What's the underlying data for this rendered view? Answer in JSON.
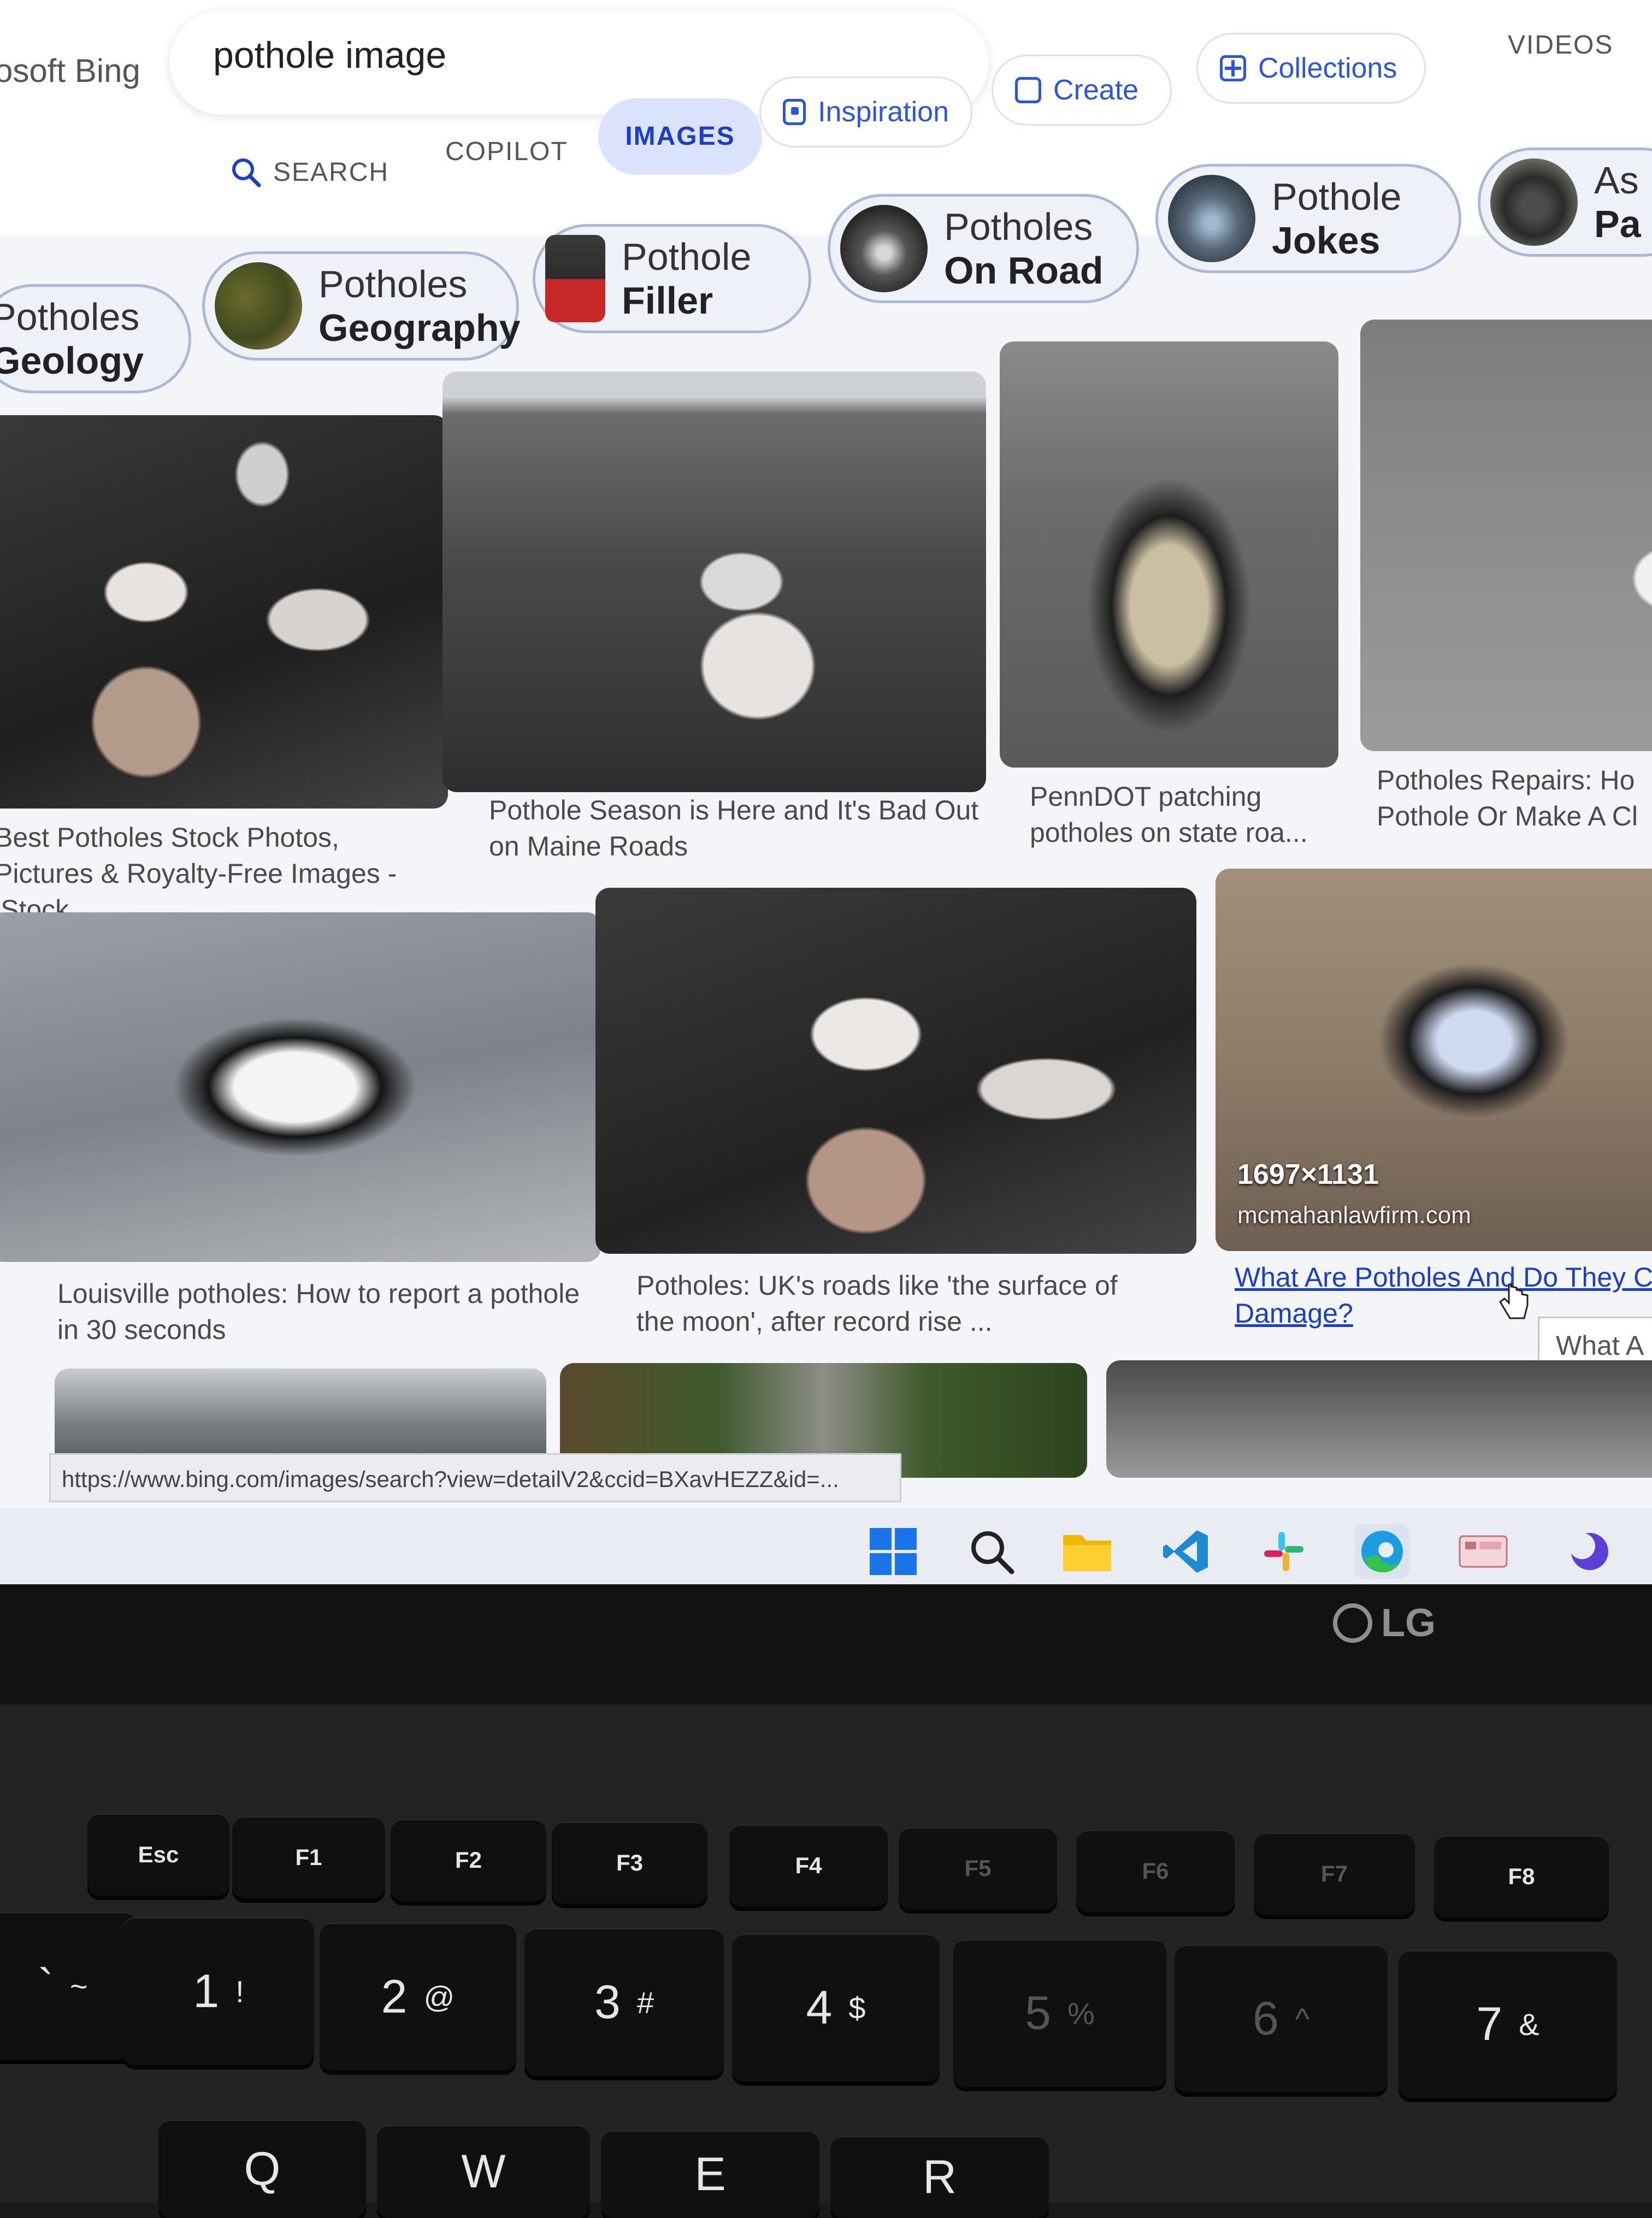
{
  "header": {
    "brand": "osoft Bing",
    "search_query": "pothole image",
    "tabs": {
      "search": "SEARCH",
      "copilot": "COPILOT",
      "images": "IMAGES",
      "videos": "VIDEOS"
    },
    "pills": {
      "inspiration": "Inspiration",
      "create": "Create",
      "collections": "Collections"
    }
  },
  "chips": [
    {
      "line1": "Potholes",
      "line2": "Geology"
    },
    {
      "line1": "Potholes",
      "line2": "Geography"
    },
    {
      "line1": "Pothole",
      "line2": "Filler"
    },
    {
      "line1": "Potholes",
      "line2": "On Road"
    },
    {
      "line1": "Pothole",
      "line2": "Jokes"
    },
    {
      "line1": "As",
      "line2": "Pa"
    }
  ],
  "results": {
    "row1": [
      {
        "caption": "Best Potholes Stock Photos, Pictures & Royalty-Free Images - iStock"
      },
      {
        "caption": "Pothole Season is Here and It's Bad Out on Maine Roads"
      },
      {
        "caption": "PennDOT patching potholes on state roa..."
      },
      {
        "caption": "Potholes Repairs: Ho Pothole Or Make A Cl"
      }
    ],
    "row2": [
      {
        "caption": "Louisville potholes: How to report a pothole in 30 seconds"
      },
      {
        "caption": "Potholes: UK's roads like 'the surface of the moon', after record rise ..."
      },
      {
        "caption": "What Are Potholes And Do They C Damage?",
        "dimensions": "1697×1131",
        "source": "mcmahanlawfirm.com"
      }
    ],
    "tooltip": "What A"
  },
  "status_url": "https://www.bing.com/images/search?view=detailV2&ccid=BXavHEZZ&id=...",
  "taskbar": [
    "windows-start",
    "search",
    "file-explorer",
    "vscode",
    "slack",
    "edge",
    "app",
    "app2"
  ],
  "laptop": {
    "brand": "LG",
    "fn_keys": [
      "Esc",
      "F1",
      "F2",
      "F3",
      "F4",
      "F5",
      "F6",
      "F7",
      "F8"
    ],
    "num_keys": [
      {
        "main": "`",
        "alt": "~"
      },
      {
        "main": "1",
        "alt": "!"
      },
      {
        "main": "2",
        "alt": "@"
      },
      {
        "main": "3",
        "alt": "#"
      },
      {
        "main": "4",
        "alt": "$"
      },
      {
        "main": "5",
        "alt": "%"
      },
      {
        "main": "6",
        "alt": "^"
      },
      {
        "main": "7",
        "alt": "&"
      }
    ],
    "letter_keys": [
      "Q",
      "W",
      "E",
      "R"
    ]
  }
}
